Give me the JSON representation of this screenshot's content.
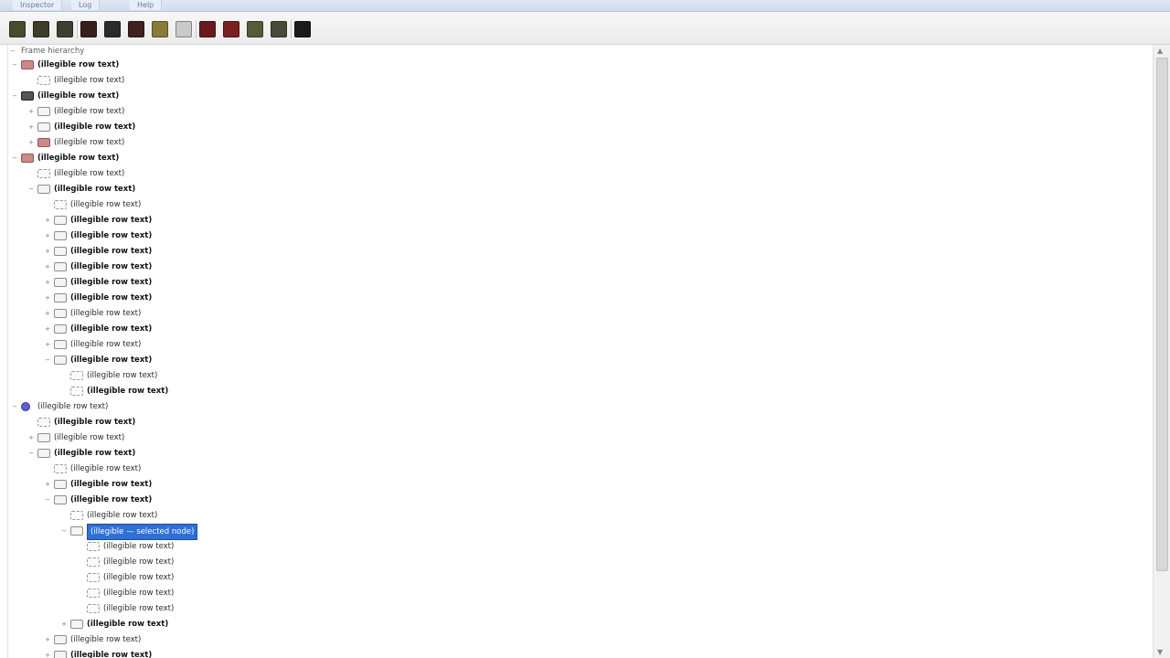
{
  "title_tabs": [
    "Inspector",
    "Log",
    "Help"
  ],
  "toolbar_buttons": [
    {
      "name": "open-icon",
      "color": "#4a4a2e"
    },
    {
      "name": "save-icon",
      "color": "#3d3d2a"
    },
    {
      "name": "refresh-icon",
      "color": "#3b4030"
    },
    {
      "name": "record-icon",
      "color": "#3a1e1e"
    },
    {
      "name": "stop-icon",
      "color": "#2b2b2b"
    },
    {
      "name": "pause-icon",
      "color": "#402020"
    },
    {
      "name": "filter-icon",
      "color": "#8a7a3a"
    },
    {
      "name": "search-icon",
      "color": "#c9c9c9"
    },
    {
      "name": "delete-icon",
      "color": "#6a1a1a"
    },
    {
      "name": "clear-icon",
      "color": "#7a2020"
    },
    {
      "name": "export-icon",
      "color": "#5a5a3a"
    },
    {
      "name": "settings-icon",
      "color": "#4a4a3a"
    },
    {
      "name": "info-icon",
      "color": "#1a1a1a"
    }
  ],
  "tree_root": "Frame hierarchy",
  "selected_text": "(illegible — selected node)",
  "tree": [
    {
      "depth": 0,
      "exp": "−",
      "icon": "red",
      "bold": true,
      "text": "(illegible row text)"
    },
    {
      "depth": 1,
      "exp": "",
      "icon": "leaf",
      "bold": false,
      "text": "(illegible row text)"
    },
    {
      "depth": 0,
      "exp": "−",
      "icon": "dark",
      "bold": true,
      "text": "(illegible row text)"
    },
    {
      "depth": 1,
      "exp": "+",
      "icon": "outline",
      "bold": false,
      "text": "(illegible row text)"
    },
    {
      "depth": 1,
      "exp": "+",
      "icon": "outline",
      "bold": true,
      "text": "(illegible row text)"
    },
    {
      "depth": 1,
      "exp": "+",
      "icon": "red",
      "bold": false,
      "text": "(illegible row text)"
    },
    {
      "depth": 0,
      "exp": "−",
      "icon": "red",
      "bold": true,
      "text": "(illegible row text)"
    },
    {
      "depth": 1,
      "exp": "",
      "icon": "leaf",
      "bold": false,
      "text": "(illegible row text)"
    },
    {
      "depth": 1,
      "exp": "−",
      "icon": "outline",
      "bold": true,
      "text": "(illegible row text)"
    },
    {
      "depth": 2,
      "exp": "",
      "icon": "leaf",
      "bold": false,
      "text": "(illegible row text)"
    },
    {
      "depth": 2,
      "exp": "+",
      "icon": "outline",
      "bold": true,
      "text": "(illegible row text)"
    },
    {
      "depth": 2,
      "exp": "+",
      "icon": "outline",
      "bold": true,
      "text": "(illegible row text)"
    },
    {
      "depth": 2,
      "exp": "+",
      "icon": "outline",
      "bold": true,
      "text": "(illegible row text)"
    },
    {
      "depth": 2,
      "exp": "+",
      "icon": "outline",
      "bold": true,
      "text": "(illegible row text)"
    },
    {
      "depth": 2,
      "exp": "+",
      "icon": "outline",
      "bold": true,
      "text": "(illegible row text)"
    },
    {
      "depth": 2,
      "exp": "+",
      "icon": "outline",
      "bold": true,
      "text": "(illegible row text)"
    },
    {
      "depth": 2,
      "exp": "+",
      "icon": "outline",
      "bold": false,
      "text": "(illegible row text)"
    },
    {
      "depth": 2,
      "exp": "+",
      "icon": "outline",
      "bold": true,
      "text": "(illegible row text)"
    },
    {
      "depth": 2,
      "exp": "+",
      "icon": "outline",
      "bold": false,
      "text": "(illegible row text)"
    },
    {
      "depth": 2,
      "exp": "−",
      "icon": "outline",
      "bold": true,
      "text": "(illegible row text)"
    },
    {
      "depth": 3,
      "exp": "",
      "icon": "leaf",
      "bold": false,
      "text": "(illegible row text)"
    },
    {
      "depth": 3,
      "exp": "",
      "icon": "leaf",
      "bold": true,
      "text": "(illegible row text)"
    },
    {
      "depth": 0,
      "exp": "−",
      "icon": "blue",
      "bold": false,
      "text": "(illegible row text)"
    },
    {
      "depth": 1,
      "exp": "",
      "icon": "leaf",
      "bold": true,
      "text": "(illegible row text)"
    },
    {
      "depth": 1,
      "exp": "+",
      "icon": "outline",
      "bold": false,
      "text": "(illegible row text)"
    },
    {
      "depth": 1,
      "exp": "−",
      "icon": "outline",
      "bold": true,
      "text": "(illegible row text)"
    },
    {
      "depth": 2,
      "exp": "",
      "icon": "leaf",
      "bold": false,
      "text": "(illegible row text)"
    },
    {
      "depth": 2,
      "exp": "+",
      "icon": "outline",
      "bold": true,
      "text": "(illegible row text)"
    },
    {
      "depth": 2,
      "exp": "−",
      "icon": "outline",
      "bold": true,
      "text": "(illegible row text)"
    },
    {
      "depth": 3,
      "exp": "",
      "icon": "leaf",
      "bold": false,
      "text": "(illegible row text)"
    },
    {
      "depth": 3,
      "exp": "−",
      "icon": "outline",
      "bold": false,
      "text": "",
      "selected": true
    },
    {
      "depth": 4,
      "exp": "",
      "icon": "leaf",
      "bold": false,
      "text": "(illegible row text)"
    },
    {
      "depth": 4,
      "exp": "",
      "icon": "leaf",
      "bold": false,
      "text": "(illegible row text)"
    },
    {
      "depth": 4,
      "exp": "",
      "icon": "leaf",
      "bold": false,
      "text": "(illegible row text)"
    },
    {
      "depth": 4,
      "exp": "",
      "icon": "leaf",
      "bold": false,
      "text": "(illegible row text)"
    },
    {
      "depth": 4,
      "exp": "",
      "icon": "leaf",
      "bold": false,
      "text": "(illegible row text)"
    },
    {
      "depth": 3,
      "exp": "+",
      "icon": "outline",
      "bold": true,
      "text": "(illegible row text)"
    },
    {
      "depth": 2,
      "exp": "+",
      "icon": "outline",
      "bold": false,
      "text": "(illegible row text)"
    },
    {
      "depth": 2,
      "exp": "+",
      "icon": "outline",
      "bold": true,
      "text": "(illegible row text)"
    }
  ]
}
